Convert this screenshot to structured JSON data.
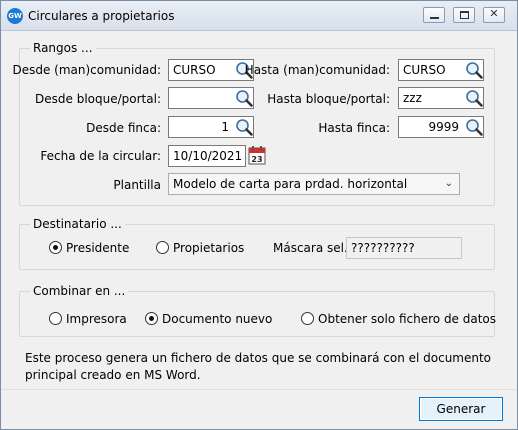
{
  "window": {
    "title": "Circulares a propietarios",
    "app_icon_text": "GW",
    "close_glyph": "✕"
  },
  "rangos": {
    "title": "Rangos ...",
    "desde_comunidad_label": "Desde (man)comunidad:",
    "desde_comunidad_value": "CURSO",
    "hasta_comunidad_label": "Hasta (man)comunidad:",
    "hasta_comunidad_value": "CURSO",
    "desde_bloque_label": "Desde bloque/portal:",
    "desde_bloque_value": "",
    "hasta_bloque_label": "Hasta bloque/portal:",
    "hasta_bloque_value": "zzz",
    "desde_finca_label": "Desde finca:",
    "desde_finca_value": "1",
    "hasta_finca_label": "Hasta finca:",
    "hasta_finca_value": "9999",
    "fecha_label": "Fecha de la circular:",
    "fecha_value": "10/10/2021",
    "calendar_day": "23",
    "plantilla_label": "Plantilla",
    "plantilla_value": "Modelo de carta para prdad. horizontal"
  },
  "destinatario": {
    "title": "Destinatario ...",
    "presidente_label": "Presidente",
    "presidente_selected": true,
    "propietarios_label": "Propietarios",
    "propietarios_selected": false,
    "mascara_label": "Máscara sel.:",
    "mascara_value": "??????????"
  },
  "combinar": {
    "title": "Combinar en ...",
    "impresora_label": "Impresora",
    "impresora_selected": false,
    "documento_label": "Documento nuevo",
    "documento_selected": true,
    "fichero_label": "Obtener solo fichero de datos",
    "fichero_selected": false
  },
  "info_text": "Este proceso genera un fichero de datos que se combinará con el documento principal creado en MS Word.",
  "generar_label": "Generar",
  "icons": {
    "lookup": "magnifier-icon",
    "calendar": "calendar-icon",
    "dropdown": "chevron-down-icon"
  },
  "colors": {
    "accent": "#0078d7",
    "calendar_red": "#d32f2f"
  }
}
